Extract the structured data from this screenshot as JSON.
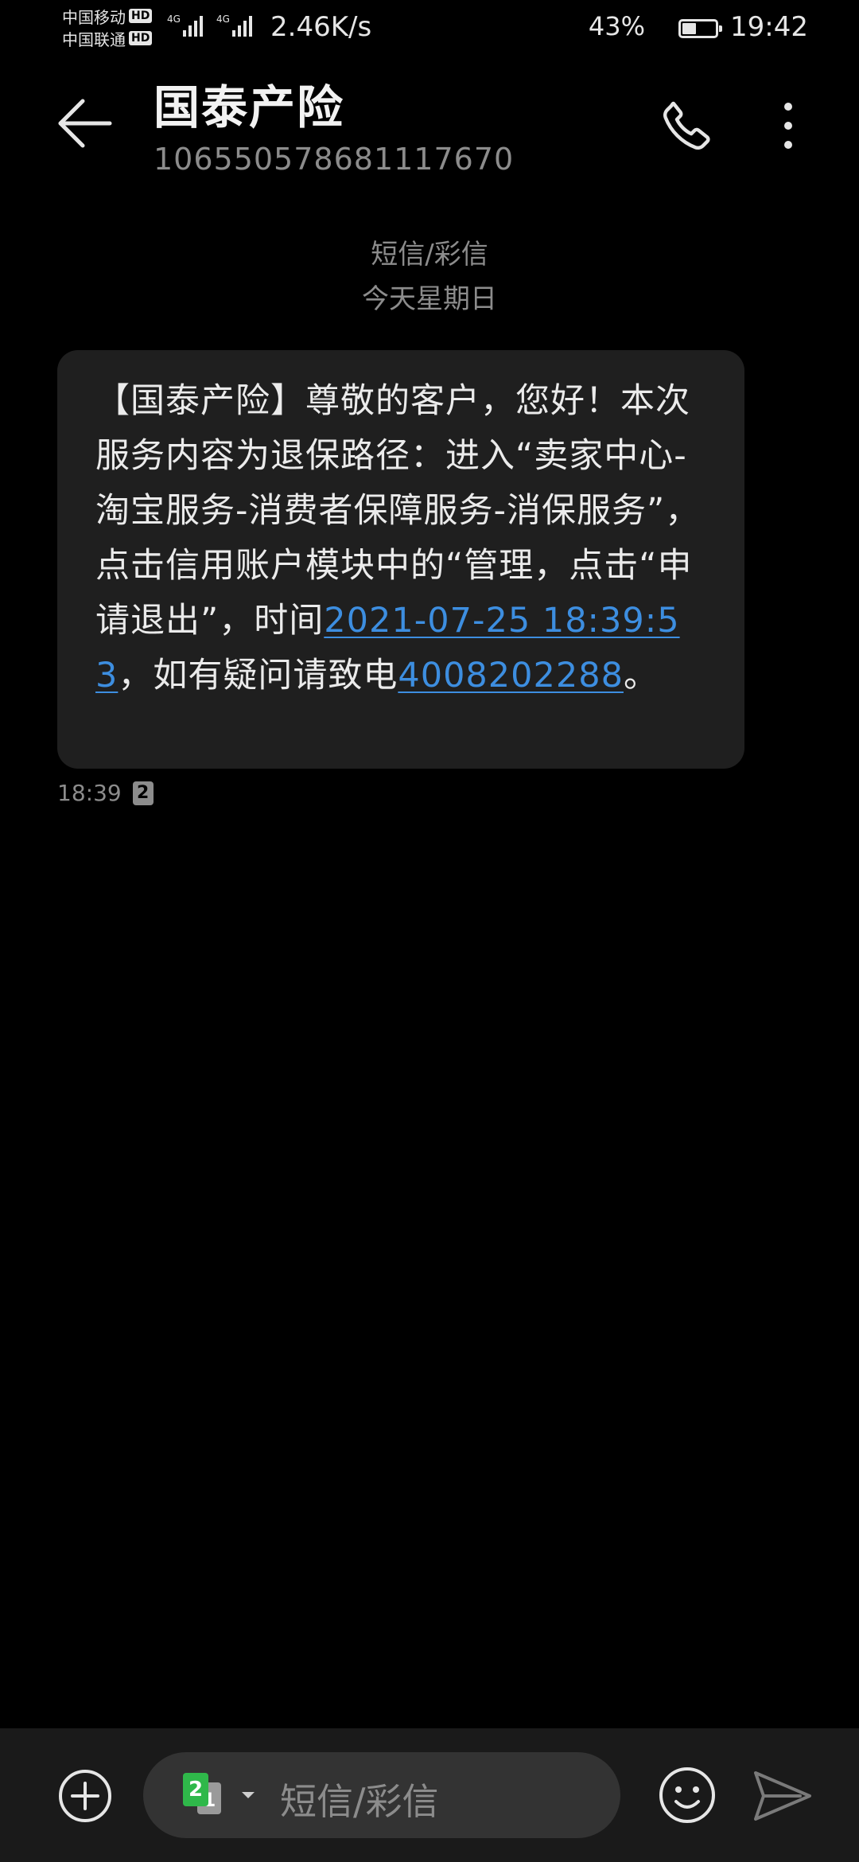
{
  "status_bar": {
    "carrier_1": "中国移动",
    "carrier_2": "中国联通",
    "hd_label": "HD",
    "network_1": "4G",
    "network_2": "4G",
    "net_speed": "2.46K/s",
    "battery_percent": "43%",
    "battery_level": 0.43,
    "time": "19:42"
  },
  "app_bar": {
    "contact_name": "国泰产险",
    "contact_number": "106550578681117670",
    "back_icon": "arrow-left-icon",
    "call_icon": "phone-icon",
    "more_icon": "more-vertical-icon"
  },
  "conversation": {
    "type_label": "短信/彩信",
    "date_label": "今天星期日",
    "messages": [
      {
        "text_part1": "【国泰产险】尊敬的客户，您好！本次服务内容为退保路径：进入“卖家中心-淘宝服务-消费者保障服务-消保服务”，点击信用账户模块中的“管理，点击“申请退出”，时间",
        "link_datetime": "2021-07-25 18:39:53",
        "text_part2": "，如有疑问请致电",
        "link_phone": "4008202288",
        "text_part3": "。",
        "time": "18:39",
        "sim": "2"
      }
    ]
  },
  "input_bar": {
    "placeholder": "短信/彩信",
    "sim_primary": "2",
    "sim_secondary": "1",
    "add_icon": "plus-circle-icon",
    "emoji_icon": "smiley-icon",
    "send_icon": "send-icon"
  },
  "colors": {
    "background": "#000000",
    "bubble": "#1f1f1f",
    "link": "#3d8ee0",
    "secondary_text": "#8c8c8c",
    "sim2_badge": "#2fb84a"
  }
}
